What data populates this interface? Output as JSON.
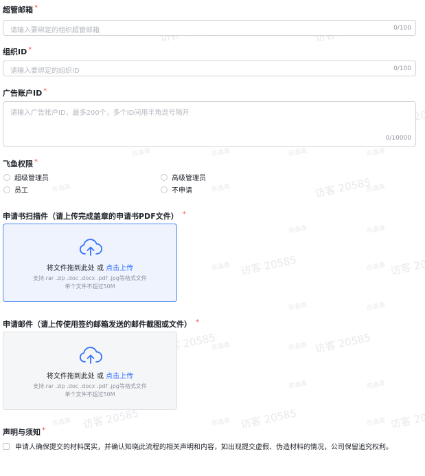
{
  "watermark": {
    "text_large": "访客 20585",
    "text_small": "陈鑫鑫"
  },
  "form": {
    "admin_email": {
      "label": "超管邮箱",
      "required": "*",
      "placeholder": "请输入要绑定的组织超管邮箱",
      "counter": "0/100"
    },
    "org_id": {
      "label": "组织ID",
      "required": "*",
      "placeholder": "请输入要绑定的组织ID",
      "counter": "0/100"
    },
    "ad_account": {
      "label": "广告账户ID",
      "required": "*",
      "placeholder": "请输入广告账户ID，最多200个，多个ID间用半角逗号隔开",
      "counter": "0/10000"
    },
    "feiyu": {
      "label": "飞鱼权限",
      "required": "*",
      "options": [
        "超级管理员",
        "高级管理员",
        "员工",
        "不申请"
      ]
    },
    "application_scan": {
      "label": "申请书扫描件（请上传完成盖章的申请书PDF文件）",
      "required": "*",
      "drop_text": "将文件拖到此处 或 ",
      "link_text": "点击上传",
      "hint1": "支持.rar .zip .doc .docx .pdf .jpg等格式文件",
      "hint2": "单个文件不超过50M"
    },
    "application_email": {
      "label": "申请邮件（请上传使用签约邮箱发送的邮件截图或文件）",
      "required": "*",
      "drop_text": "将文件拖到此处 或 ",
      "link_text": "点击上传",
      "hint1": "支持.rar .zip .doc .docx .pdf .jpg等格式文件",
      "hint2": "单个文件不超过50M"
    },
    "declaration": {
      "label": "声明与须知",
      "required": "*",
      "checkbox_text": "申请人确保提交的材料属实，并确认知晓此流程的相关声明和内容，如出现提交虚假、伪造材料的情况，公司保留追究权利。"
    }
  },
  "colors": {
    "accent": "#3370ff",
    "required": "#f54a45",
    "active_border": "#4c88f5"
  }
}
